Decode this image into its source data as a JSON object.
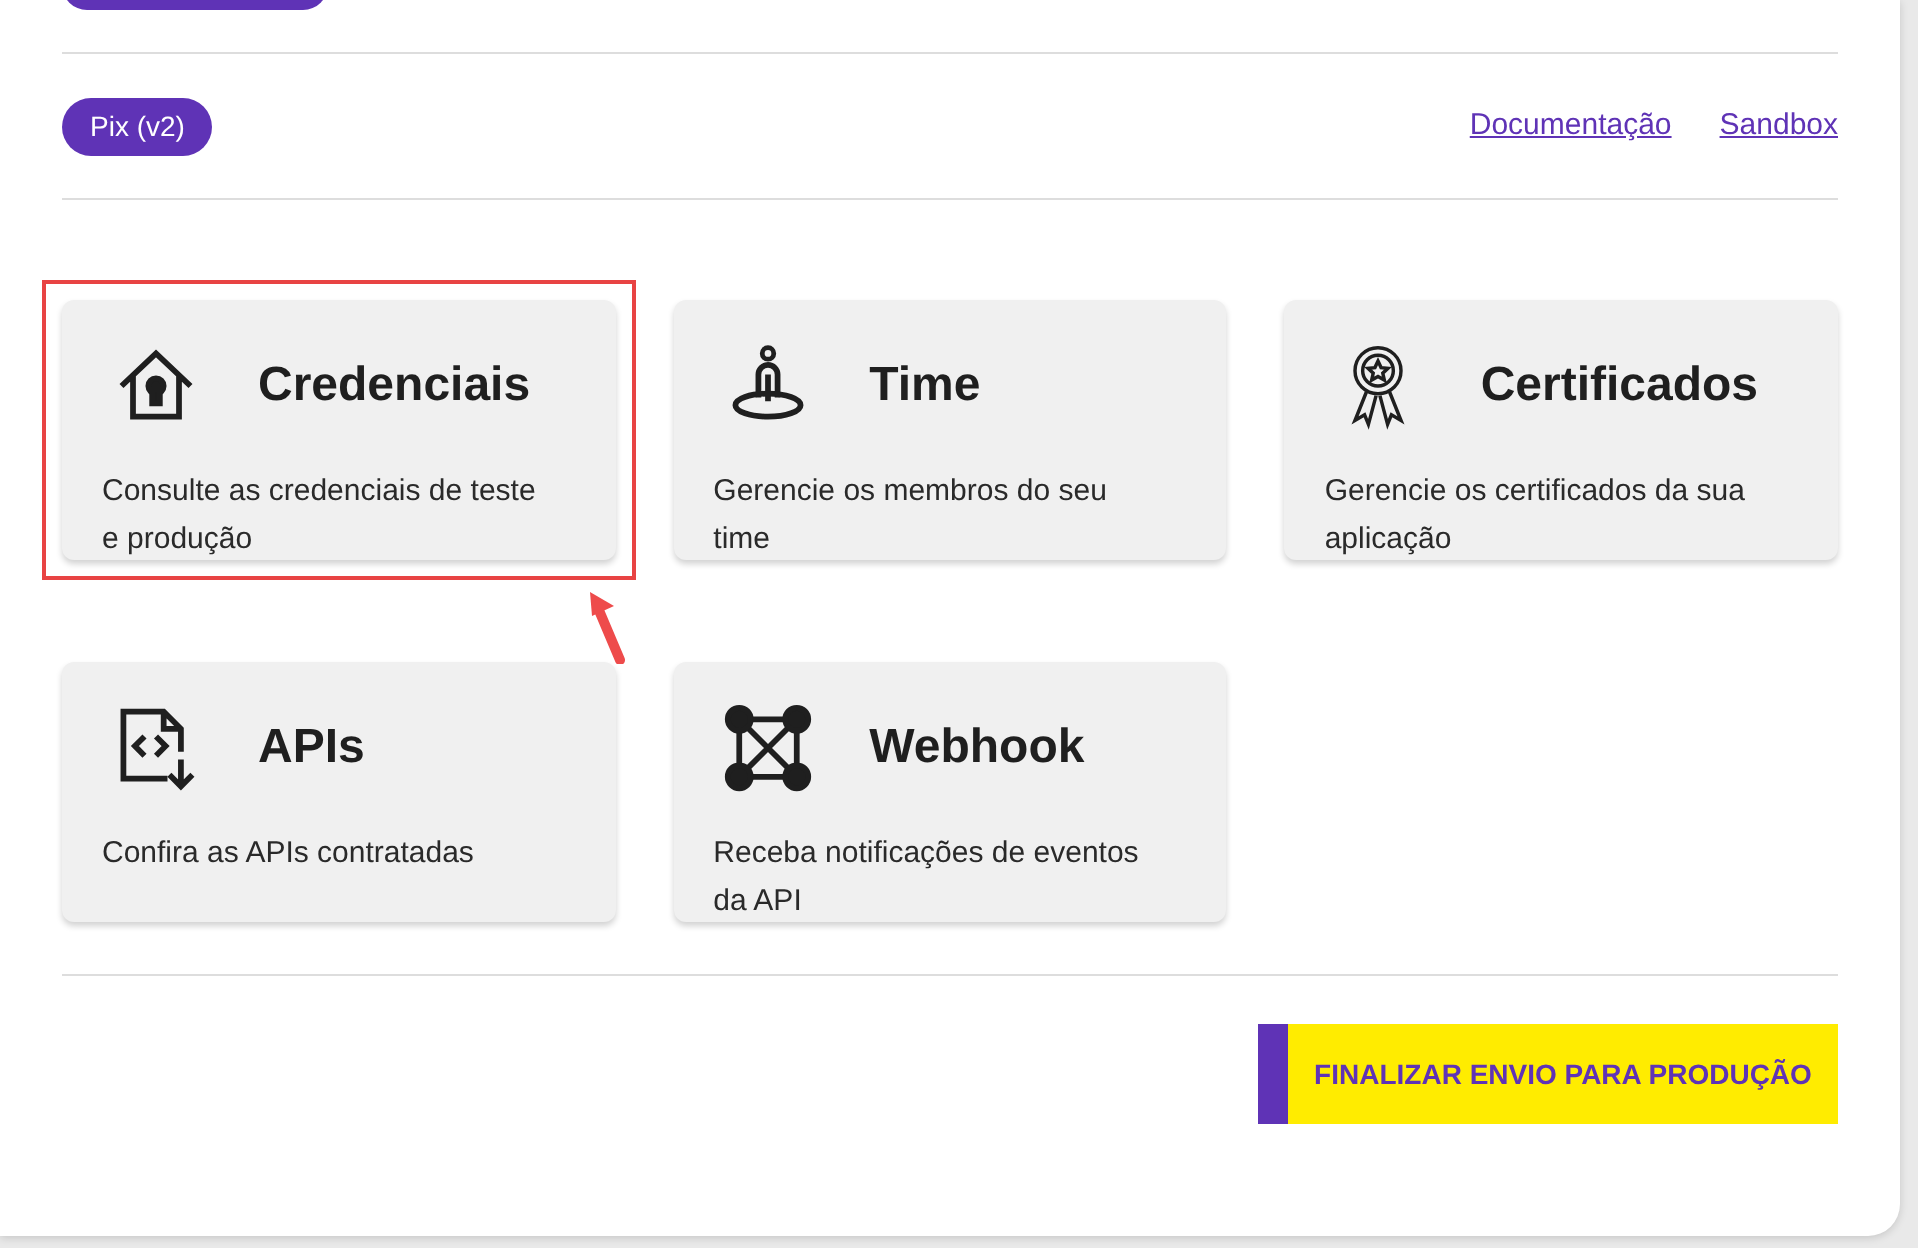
{
  "header": {
    "badge": "Pix (v2)",
    "links": [
      "Documentação",
      "Sandbox"
    ]
  },
  "cards": [
    {
      "kind": "credentials",
      "title": "Credenciais",
      "description": "Consulte as credenciais de teste e produção",
      "highlighted": true
    },
    {
      "kind": "team",
      "title": "Time",
      "description": "Gerencie os membros do seu time",
      "highlighted": false
    },
    {
      "kind": "certificates",
      "title": "Certificados",
      "description": "Gerencie os certificados da sua aplicação",
      "highlighted": false
    },
    {
      "kind": "apis",
      "title": "APIs",
      "description": "Confira as APIs contratadas",
      "highlighted": false
    },
    {
      "kind": "webhook",
      "title": "Webhook",
      "description": "Receba notificações de eventos da API",
      "highlighted": false
    }
  ],
  "footer": {
    "button": "FINALIZAR ENVIO PARA PRODUÇÃO"
  }
}
